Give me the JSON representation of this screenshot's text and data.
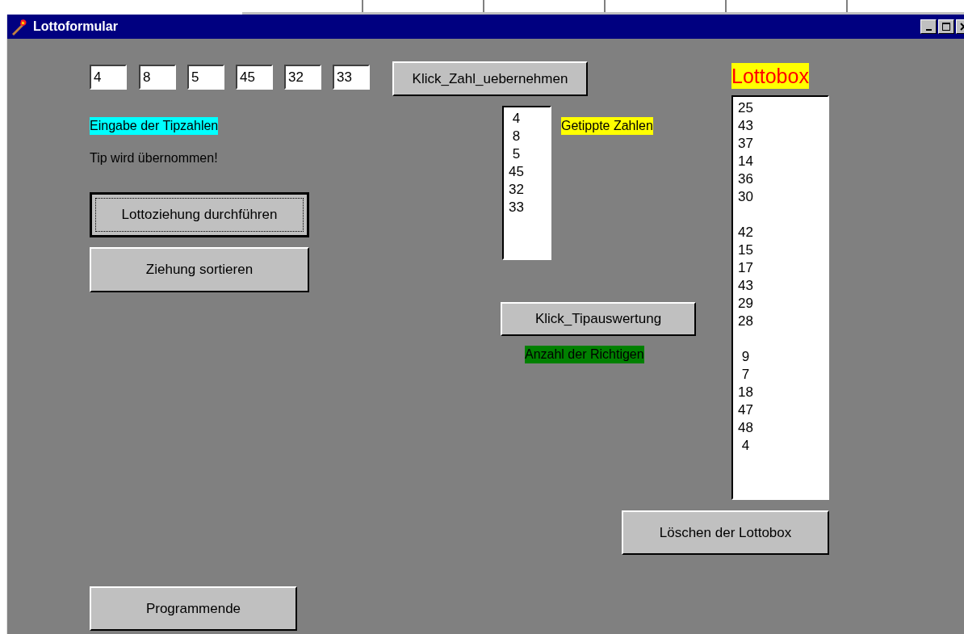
{
  "window": {
    "title": "Lottoformular"
  },
  "tip_fields": [
    {
      "value": "4"
    },
    {
      "value": "8"
    },
    {
      "value": "5"
    },
    {
      "value": "45"
    },
    {
      "value": "32"
    },
    {
      "value": "33"
    }
  ],
  "buttons": [
    {
      "kind": "take",
      "label": "Klick_Zahl_uebernehmen",
      "focused": false
    },
    {
      "kind": "draw",
      "label": "Lottoziehung durchführen",
      "focused": true
    },
    {
      "kind": "sort",
      "label": "Ziehung sortieren",
      "focused": false
    },
    {
      "kind": "evaluate",
      "label": "Klick_Tipauswertung",
      "focused": false
    },
    {
      "kind": "clear",
      "label": "Löschen der Lottobox",
      "focused": false
    },
    {
      "kind": "exit",
      "label": "Programmende",
      "focused": false
    }
  ],
  "labels": [
    {
      "kind": "input",
      "text": "Eingabe der Tipzahlen",
      "color": "#00ffff"
    },
    {
      "kind": "status",
      "text": "Tip wird übernommen!"
    },
    {
      "kind": "tips",
      "text": "Getippte Zahlen",
      "color": "#ffff00"
    },
    {
      "kind": "hits",
      "text": "Anzahl der Richtigen",
      "color": "#008000"
    },
    {
      "kind": "box",
      "text": "Lottobox",
      "color": "#ffff00"
    }
  ],
  "tip_list": {
    "items": [
      " 4",
      " 8",
      " 5",
      "45",
      "32",
      "33"
    ]
  },
  "lottobox": {
    "groups": [
      [
        "25",
        "43",
        "37",
        "14",
        "36",
        "30"
      ],
      [
        "42",
        "15",
        "17",
        "43",
        "29",
        "28"
      ],
      [
        " 9",
        " 7",
        "18",
        "47",
        "48",
        " 4"
      ]
    ]
  }
}
